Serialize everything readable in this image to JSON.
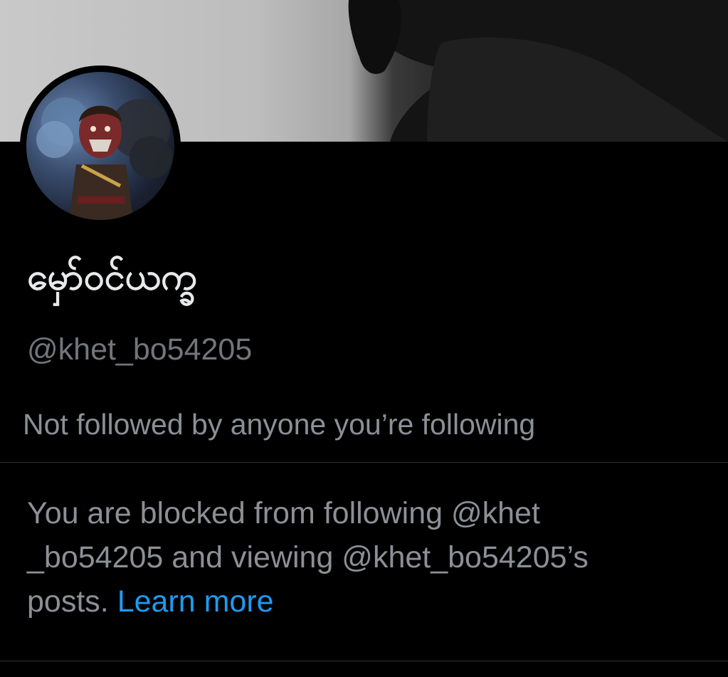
{
  "profile": {
    "display_name": "မှော်ဝင်ယက္ခ",
    "handle": "@khet_bo54205",
    "followers_note": "Not followed by anyone you’re following"
  },
  "blocked": {
    "line1": "You are blocked from following @khet",
    "line2": "_bo54205 and viewing @khet_bo54205’s",
    "line3": "posts.",
    "learn_more": "Learn more"
  },
  "colors": {
    "background": "#000000",
    "primary_text": "#e7e9ea",
    "secondary_text": "#71767b",
    "link": "#1d9bf0",
    "divider": "#2f3336"
  }
}
